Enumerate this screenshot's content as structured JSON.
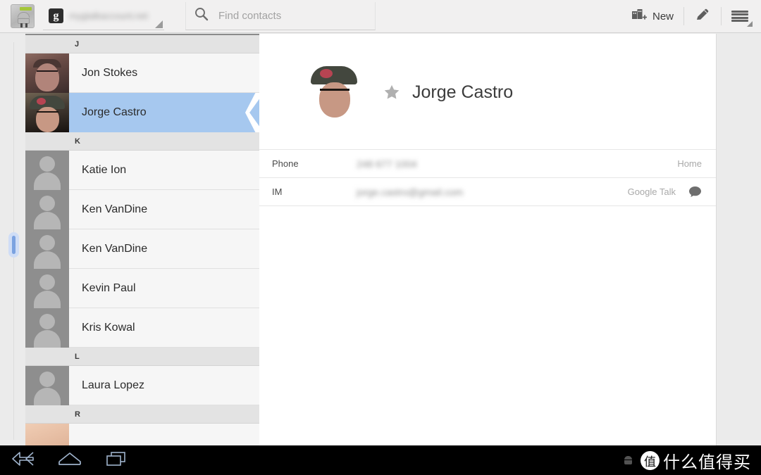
{
  "actionbar": {
    "app_icon_name": "contacts-app-icon",
    "account": {
      "logo_text": "g",
      "email": "mygtalkaccount.net",
      "caret_name": "dropdown-caret"
    },
    "search": {
      "placeholder": "Find contacts",
      "value": ""
    },
    "new_label": "New",
    "edit_icon_name": "pencil-icon",
    "menu_icon_name": "hamburger-menu-icon"
  },
  "contact_list": {
    "sections": [
      {
        "letter": "J",
        "contacts": [
          {
            "name": "Jon Stokes",
            "avatar": "photo-jon",
            "selected": false
          },
          {
            "name": "Jorge Castro",
            "avatar": "photo-jorge",
            "selected": true
          }
        ]
      },
      {
        "letter": "K",
        "contacts": [
          {
            "name": "Katie Ion",
            "avatar": "placeholder",
            "selected": false
          },
          {
            "name": "Ken VanDine",
            "avatar": "placeholder",
            "selected": false
          },
          {
            "name": "Ken VanDine",
            "avatar": "placeholder",
            "selected": false
          },
          {
            "name": "Kevin Paul",
            "avatar": "placeholder",
            "selected": false
          },
          {
            "name": "Kris Kowal",
            "avatar": "placeholder",
            "selected": false
          }
        ]
      },
      {
        "letter": "L",
        "contacts": [
          {
            "name": "Laura Lopez",
            "avatar": "placeholder",
            "selected": false
          }
        ]
      },
      {
        "letter": "R",
        "contacts": [
          {
            "name": "",
            "avatar": "photo-partial",
            "selected": false
          }
        ]
      }
    ]
  },
  "detail": {
    "name": "Jorge Castro",
    "starred": false,
    "star_color": "#b0b0b0",
    "photo_name": "contact-photo-jorge",
    "fields": [
      {
        "label": "Phone",
        "value": "248 677 1004",
        "type": "Home",
        "has_chat_icon": false
      },
      {
        "label": "IM",
        "value": "jorge.castro@gmail.com",
        "type": "Google Talk",
        "has_chat_icon": true
      }
    ]
  },
  "system_bar": {
    "back_icon": "back-icon",
    "home_icon": "home-icon",
    "recents_icon": "recent-apps-icon",
    "status_icon": "android-status-icon",
    "watermark_logo": "值",
    "watermark_text": "什么值得买"
  },
  "colors": {
    "selection_blue": "#a6c8ef",
    "actionbar_bg": "#f1f0f0",
    "list_bg": "#f6f6f6",
    "section_header_bg": "#e3e3e3",
    "detail_bg": "#ffffff",
    "sysbar_bg": "#000000"
  }
}
